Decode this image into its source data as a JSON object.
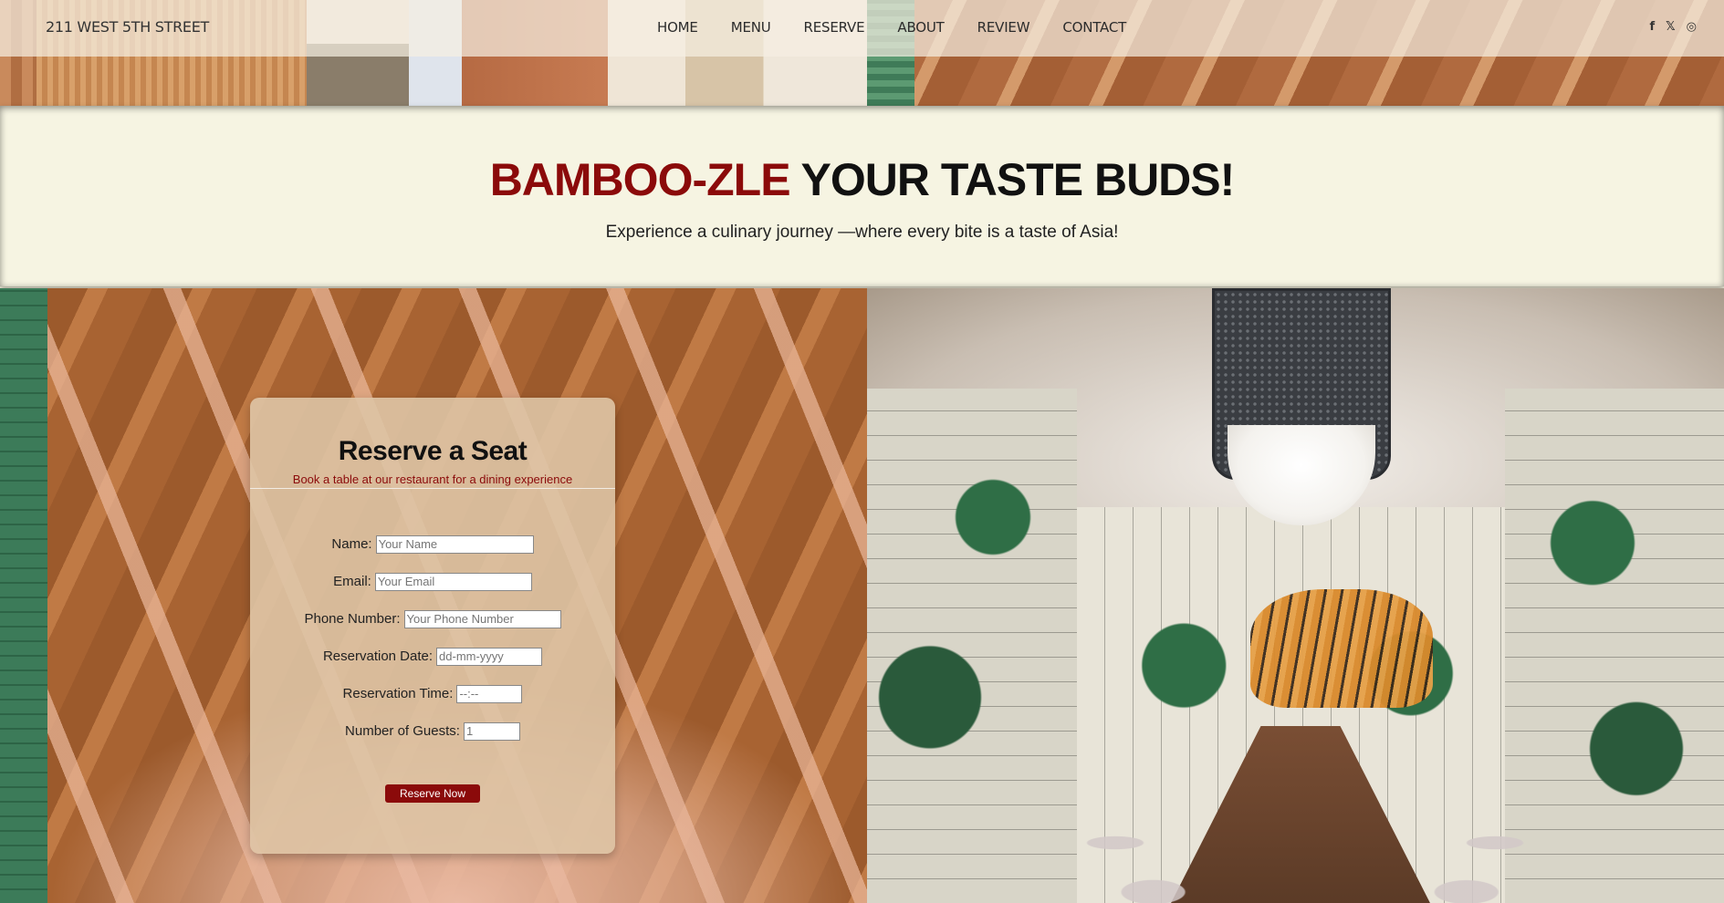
{
  "header": {
    "address": "211 WEST 5TH STREET",
    "nav": [
      "HOME",
      "MENU",
      "RESERVE",
      "ABOUT",
      "REVIEW",
      "CONTACT"
    ],
    "social_icons": [
      "facebook-icon",
      "x-icon",
      "instagram-icon"
    ],
    "social_glyphs": [
      "f",
      "𝕏",
      "◎"
    ]
  },
  "hero": {
    "title_accent": "BAMBOO-ZLE",
    "title_rest": " YOUR TASTE BUDS!",
    "subtitle": "Experience a culinary journey —where every bite is a taste of Asia!"
  },
  "reservation": {
    "title": "Reserve a Seat",
    "subtitle": "Book a table at our restaurant for a dining experience",
    "fields": {
      "name_label": "Name:",
      "name_placeholder": "Your Name",
      "email_label": "Email:",
      "email_placeholder": "Your Email",
      "phone_label": "Phone Number:",
      "phone_placeholder": "Your Phone Number",
      "date_label": "Reservation Date:",
      "date_value": "dd-mm-yyyy",
      "time_label": "Reservation Time:",
      "time_value": "--:--",
      "guests_label": "Number of Guests:",
      "guests_placeholder": "1"
    },
    "submit_label": "Reserve Now"
  },
  "colors": {
    "accent": "#8b0a0a",
    "hero_bg": "#f6f4e2",
    "card_bg": "#dec4a5"
  }
}
